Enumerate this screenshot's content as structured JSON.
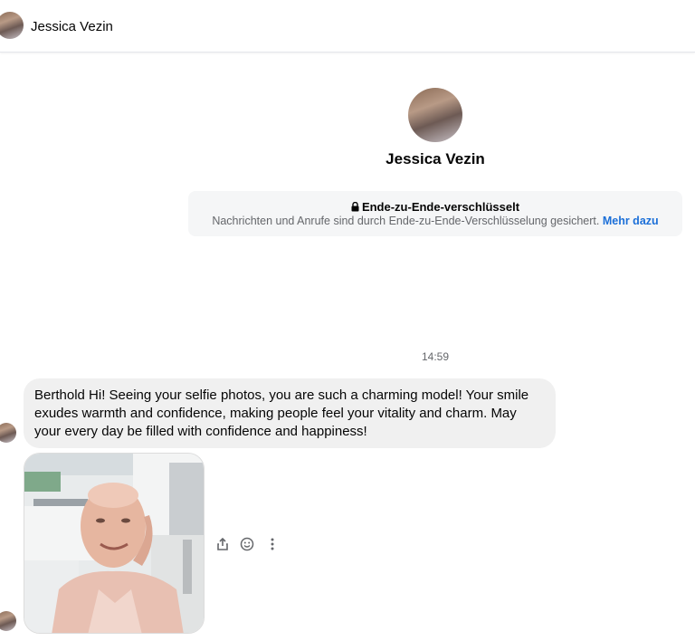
{
  "header": {
    "name": "Jessica Vezin"
  },
  "profile": {
    "name": "Jessica Vezin"
  },
  "encryption": {
    "title": "Ende-zu-Ende-verschlüsselt",
    "description": "Nachrichten und Anrufe sind durch Ende-zu-Ende-Verschlüsselung gesichert.",
    "link": "Mehr dazu"
  },
  "conversation": {
    "timestamp": "14:59",
    "messages": [
      {
        "text": "Berthold Hi! Seeing your selfie photos, you are such a charming model! Your smile exudes warmth and confidence, making people feel your vitality and charm. May your every day be filled with confidence and happiness!"
      }
    ]
  },
  "icons": {
    "lock": "lock-icon",
    "share": "share-icon",
    "react": "smiley-icon",
    "more": "more-vertical-icon"
  },
  "colors": {
    "link": "#1b6fd8",
    "bubble": "#f0f0f0",
    "banner": "#f5f6f7"
  }
}
